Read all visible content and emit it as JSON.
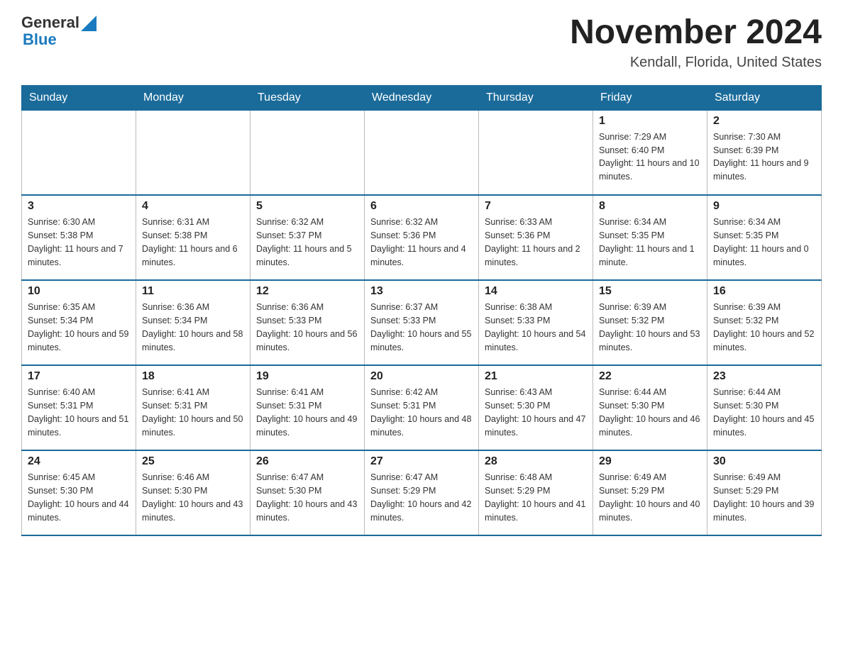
{
  "header": {
    "logo_general": "General",
    "logo_blue": "Blue",
    "title": "November 2024",
    "subtitle": "Kendall, Florida, United States"
  },
  "days_of_week": [
    "Sunday",
    "Monday",
    "Tuesday",
    "Wednesday",
    "Thursday",
    "Friday",
    "Saturday"
  ],
  "weeks": [
    [
      {
        "day": "",
        "info": ""
      },
      {
        "day": "",
        "info": ""
      },
      {
        "day": "",
        "info": ""
      },
      {
        "day": "",
        "info": ""
      },
      {
        "day": "",
        "info": ""
      },
      {
        "day": "1",
        "info": "Sunrise: 7:29 AM\nSunset: 6:40 PM\nDaylight: 11 hours and 10 minutes."
      },
      {
        "day": "2",
        "info": "Sunrise: 7:30 AM\nSunset: 6:39 PM\nDaylight: 11 hours and 9 minutes."
      }
    ],
    [
      {
        "day": "3",
        "info": "Sunrise: 6:30 AM\nSunset: 5:38 PM\nDaylight: 11 hours and 7 minutes."
      },
      {
        "day": "4",
        "info": "Sunrise: 6:31 AM\nSunset: 5:38 PM\nDaylight: 11 hours and 6 minutes."
      },
      {
        "day": "5",
        "info": "Sunrise: 6:32 AM\nSunset: 5:37 PM\nDaylight: 11 hours and 5 minutes."
      },
      {
        "day": "6",
        "info": "Sunrise: 6:32 AM\nSunset: 5:36 PM\nDaylight: 11 hours and 4 minutes."
      },
      {
        "day": "7",
        "info": "Sunrise: 6:33 AM\nSunset: 5:36 PM\nDaylight: 11 hours and 2 minutes."
      },
      {
        "day": "8",
        "info": "Sunrise: 6:34 AM\nSunset: 5:35 PM\nDaylight: 11 hours and 1 minute."
      },
      {
        "day": "9",
        "info": "Sunrise: 6:34 AM\nSunset: 5:35 PM\nDaylight: 11 hours and 0 minutes."
      }
    ],
    [
      {
        "day": "10",
        "info": "Sunrise: 6:35 AM\nSunset: 5:34 PM\nDaylight: 10 hours and 59 minutes."
      },
      {
        "day": "11",
        "info": "Sunrise: 6:36 AM\nSunset: 5:34 PM\nDaylight: 10 hours and 58 minutes."
      },
      {
        "day": "12",
        "info": "Sunrise: 6:36 AM\nSunset: 5:33 PM\nDaylight: 10 hours and 56 minutes."
      },
      {
        "day": "13",
        "info": "Sunrise: 6:37 AM\nSunset: 5:33 PM\nDaylight: 10 hours and 55 minutes."
      },
      {
        "day": "14",
        "info": "Sunrise: 6:38 AM\nSunset: 5:33 PM\nDaylight: 10 hours and 54 minutes."
      },
      {
        "day": "15",
        "info": "Sunrise: 6:39 AM\nSunset: 5:32 PM\nDaylight: 10 hours and 53 minutes."
      },
      {
        "day": "16",
        "info": "Sunrise: 6:39 AM\nSunset: 5:32 PM\nDaylight: 10 hours and 52 minutes."
      }
    ],
    [
      {
        "day": "17",
        "info": "Sunrise: 6:40 AM\nSunset: 5:31 PM\nDaylight: 10 hours and 51 minutes."
      },
      {
        "day": "18",
        "info": "Sunrise: 6:41 AM\nSunset: 5:31 PM\nDaylight: 10 hours and 50 minutes."
      },
      {
        "day": "19",
        "info": "Sunrise: 6:41 AM\nSunset: 5:31 PM\nDaylight: 10 hours and 49 minutes."
      },
      {
        "day": "20",
        "info": "Sunrise: 6:42 AM\nSunset: 5:31 PM\nDaylight: 10 hours and 48 minutes."
      },
      {
        "day": "21",
        "info": "Sunrise: 6:43 AM\nSunset: 5:30 PM\nDaylight: 10 hours and 47 minutes."
      },
      {
        "day": "22",
        "info": "Sunrise: 6:44 AM\nSunset: 5:30 PM\nDaylight: 10 hours and 46 minutes."
      },
      {
        "day": "23",
        "info": "Sunrise: 6:44 AM\nSunset: 5:30 PM\nDaylight: 10 hours and 45 minutes."
      }
    ],
    [
      {
        "day": "24",
        "info": "Sunrise: 6:45 AM\nSunset: 5:30 PM\nDaylight: 10 hours and 44 minutes."
      },
      {
        "day": "25",
        "info": "Sunrise: 6:46 AM\nSunset: 5:30 PM\nDaylight: 10 hours and 43 minutes."
      },
      {
        "day": "26",
        "info": "Sunrise: 6:47 AM\nSunset: 5:30 PM\nDaylight: 10 hours and 43 minutes."
      },
      {
        "day": "27",
        "info": "Sunrise: 6:47 AM\nSunset: 5:29 PM\nDaylight: 10 hours and 42 minutes."
      },
      {
        "day": "28",
        "info": "Sunrise: 6:48 AM\nSunset: 5:29 PM\nDaylight: 10 hours and 41 minutes."
      },
      {
        "day": "29",
        "info": "Sunrise: 6:49 AM\nSunset: 5:29 PM\nDaylight: 10 hours and 40 minutes."
      },
      {
        "day": "30",
        "info": "Sunrise: 6:49 AM\nSunset: 5:29 PM\nDaylight: 10 hours and 39 minutes."
      }
    ]
  ]
}
